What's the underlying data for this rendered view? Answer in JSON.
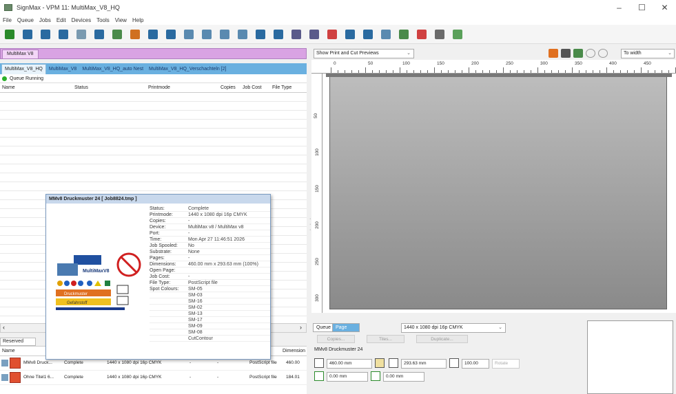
{
  "window": {
    "title": "SignMax - VPM 11: MultiMax_V8_HQ",
    "minimize": "–",
    "maximize": "☐",
    "close": "✕"
  },
  "menu": [
    "File",
    "Queue",
    "Jobs",
    "Edit",
    "Devices",
    "Tools",
    "View",
    "Help"
  ],
  "toolbar_icons": [
    "add-job-icon",
    "add-job-2-icon",
    "add-job-3-icon",
    "add-job-4-icon",
    "reprint-icon",
    "tile-icon",
    "nest-icon",
    "color-icon",
    "edit-icon",
    "properties-icon",
    "import-icon",
    "export-icon",
    "copy-icon",
    "print-icon",
    "pause-icon",
    "delete-icon",
    "cut-icon",
    "cut-2-icon",
    "hold-icon",
    "release-icon",
    "send-icon",
    "preflight-icon",
    "nest-2-icon",
    "spot-color-icon",
    "ink-icon",
    "profile-icon"
  ],
  "device_tab": "MultiMax V8",
  "queue_tabs": [
    "MultiMax_V8_HQ",
    "MultiMax_V8",
    "MultiMax_V8_HQ_auto Nest",
    "MultiMax_V8_HQ_Verschachteln [2]"
  ],
  "queue_status": "Queue Running",
  "grid_headers": [
    "Name",
    "Status",
    "Printmode",
    "Copies",
    "Job Cost",
    "File Type"
  ],
  "reserved_label": "Reserved",
  "reserved_headers": {
    "name": "Name",
    "dimension": "Dimension"
  },
  "reserved_rows": [
    {
      "name": "MMv8 Druck...",
      "status": "Complete",
      "printmode": "1440 x 1080 dpi 16p CMYK",
      "c1": "-",
      "c2": "-",
      "filetype": "PostScript file",
      "dim": "460.00"
    },
    {
      "name": "Ohne Titel1 6...",
      "status": "Complete",
      "printmode": "1440 x 1080 dpi 16p CMYK",
      "c1": "-",
      "c2": "-",
      "filetype": "PostScript file",
      "dim": "184.01"
    }
  ],
  "popup": {
    "title": "MMv8 Druckmuster 24 [ Job8824.tmp ]",
    "fields": [
      {
        "k": "Status:",
        "v": "Complete"
      },
      {
        "k": "Printmode:",
        "v": "1440 x 1080 dpi 16p CMYK"
      },
      {
        "k": "Copies:",
        "v": "-"
      },
      {
        "k": "Device:",
        "v": "MultiMax v8 / MultiMax v8"
      },
      {
        "k": "Port:",
        "v": "-"
      },
      {
        "k": "Time:",
        "v": "Mon Apr 27 11:46:51 2026"
      },
      {
        "k": "Job Spooled:",
        "v": "No"
      },
      {
        "k": "Substrate:",
        "v": "None"
      },
      {
        "k": "Pages:",
        "v": "-"
      },
      {
        "k": "Dimensions:",
        "v": "460.00 mm x 293.63 mm (100%)"
      },
      {
        "k": "Open Page:",
        "v": ""
      },
      {
        "k": "Job Cost:",
        "v": "-"
      },
      {
        "k": "File Type:",
        "v": "PostScript file"
      },
      {
        "k": "Spot Colours:",
        "v": "SM-05"
      },
      {
        "k": "",
        "v": "SM-03"
      },
      {
        "k": "",
        "v": "SM-16"
      },
      {
        "k": "",
        "v": "SM-02"
      },
      {
        "k": "",
        "v": "SM-13"
      },
      {
        "k": "",
        "v": "SM-17"
      },
      {
        "k": "",
        "v": "SM-09"
      },
      {
        "k": "",
        "v": "SM-08"
      },
      {
        "k": "",
        "v": "CutContour"
      }
    ],
    "preview_text": {
      "logo": "MultiMaxV8",
      "strip1": "Druckmuster",
      "strip2": "Gefahrstoff"
    }
  },
  "preview": {
    "mode": "Show Print and Cut Previews",
    "zoom": "To width",
    "hruler": [
      "0",
      "50",
      "100",
      "150",
      "200",
      "250",
      "300",
      "350",
      "400",
      "450"
    ],
    "vruler": [
      "50",
      "100",
      "150",
      "200",
      "250",
      "300"
    ]
  },
  "bottom": {
    "tab_queue": "Queue",
    "tab_page": "Page",
    "printmode": "1440 x 1080 dpi 16p CMYK",
    "copies": "Copies...",
    "tiles": "Tiles...",
    "duplicate": "Duplicate...",
    "jobname": "MMv8 Druckmuster 24",
    "width": "460.00 mm",
    "height": "293.63 mm",
    "scale": "100.00",
    "rotate": "Rotate",
    "xoff": "0.00 mm",
    "yoff": "0.00 mm"
  },
  "colors": {
    "accent_purple": "#d9a3e3",
    "accent_blue": "#6ab0e0",
    "running_green": "#2ab02a"
  }
}
